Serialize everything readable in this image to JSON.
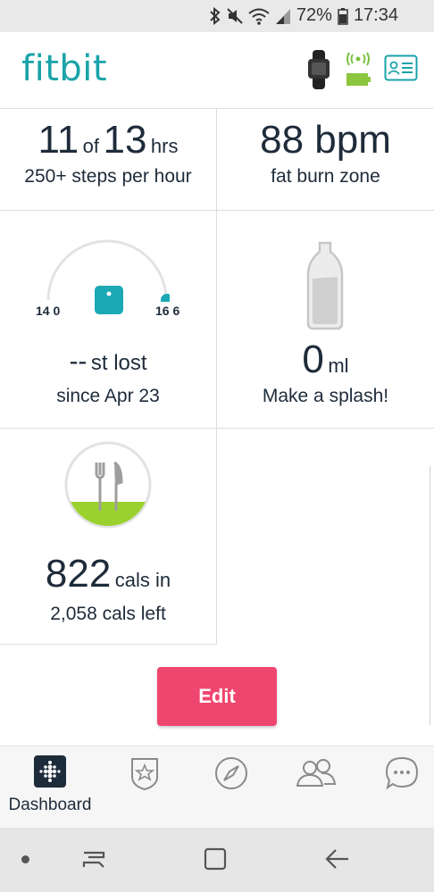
{
  "status_bar": {
    "battery": "72%",
    "time": "17:34"
  },
  "app": {
    "logo": "fitbit"
  },
  "tiles": {
    "active_hours": {
      "current": "11",
      "of": "of",
      "goal": "13",
      "unit": "hrs",
      "subtitle": "250+ steps per hour"
    },
    "heart_rate": {
      "value": "88 bpm",
      "subtitle": "fat burn zone"
    },
    "weight": {
      "start": "14 0",
      "end": "16 6",
      "value": "--",
      "label": "st lost",
      "subtitle": "since Apr 23"
    },
    "water": {
      "value": "0",
      "unit": "ml",
      "subtitle": "Make a splash!"
    },
    "food": {
      "value": "822",
      "unit": "cals in",
      "subtitle": "2,058 cals left"
    }
  },
  "edit_button": {
    "label": "Edit"
  },
  "bottom_nav": {
    "dashboard_label": "Dashboard"
  },
  "colors": {
    "teal": "#1aa3a8",
    "edit": "#ef4670",
    "food_green": "#9bd12e",
    "battery_green": "#8cc63f"
  },
  "icons": [
    "bluetooth-icon",
    "mute-icon",
    "wifi-icon",
    "signal-icon",
    "battery-icon",
    "tracker-icon",
    "sync-icon",
    "profile-card-icon",
    "scale-icon",
    "water-bottle-icon",
    "fork-knife-icon",
    "dashboard-icon",
    "challenges-star-icon",
    "discover-compass-icon",
    "friends-icon",
    "messages-icon",
    "recents-icon",
    "home-icon",
    "back-icon"
  ]
}
